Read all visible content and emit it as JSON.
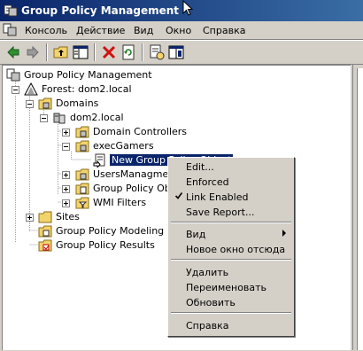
{
  "window": {
    "title": "Group Policy Management"
  },
  "menubar": {
    "items": [
      {
        "label": "Консоль"
      },
      {
        "label": "Действие"
      },
      {
        "label": "Вид"
      },
      {
        "label": "Окно"
      },
      {
        "label": "Справка"
      }
    ]
  },
  "toolbar": {
    "icons": [
      "back-arrow-icon",
      "forward-arrow-icon",
      "up-folder-icon",
      "show-hide-tree-icon",
      "delete-icon",
      "refresh-icon",
      "properties-icon",
      "help-icon"
    ]
  },
  "tree": {
    "root": "Group Policy Management",
    "forest": "Forest: dom2.local",
    "domains": "Domains",
    "domain": "dom2.local",
    "domain_controllers": "Domain Controllers",
    "exec_gamers": "execGamers",
    "gpo_link": "New Group Policy Object",
    "users": "UsersManagment",
    "gpo_folder": "Group Policy Objects",
    "wmi": "WMI Filters",
    "sites": "Sites",
    "modeling": "Group Policy Modeling",
    "results": "Group Policy Results"
  },
  "context_menu": {
    "edit": "Edit...",
    "enforced": "Enforced",
    "link_enabled": "Link Enabled",
    "save_report": "Save Report...",
    "view": "Вид",
    "new_window": "Новое окно отсюда",
    "delete": "Удалить",
    "rename": "Переименовать",
    "refresh": "Обновить",
    "help": "Справка"
  },
  "colors": {
    "title_bar": "#0a246a",
    "selection": "#0a246a",
    "chrome": "#d4d0c8"
  }
}
